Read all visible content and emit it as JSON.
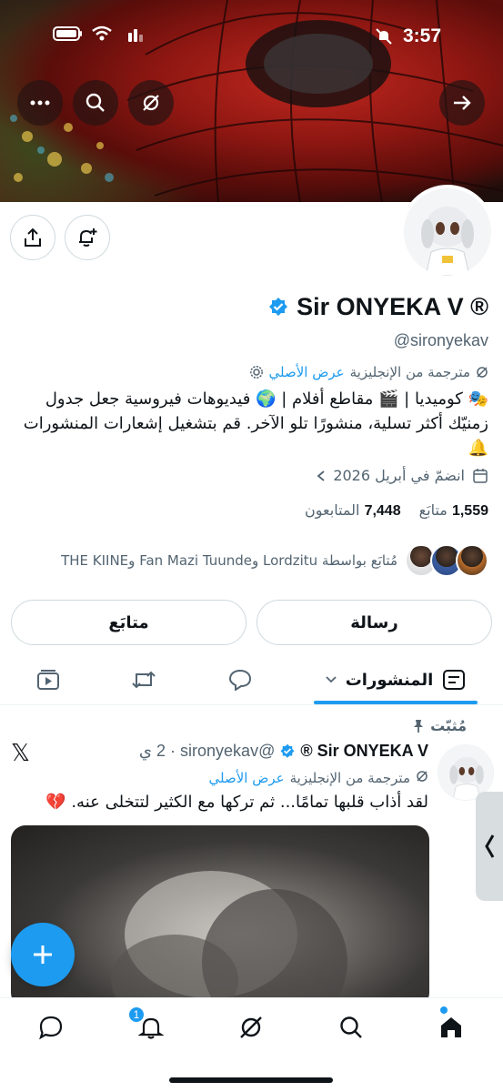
{
  "status_bar": {
    "time": "3:57"
  },
  "profile": {
    "display_name": "Sir ONYEKA V ®",
    "handle": "@sironyekav",
    "translated_label": "مترجمة من الإنجليزية",
    "show_original": "عرض الأصلي",
    "bio": "🎭 كوميديا | 🎬 مقاطع أفلام | 🌍 فيديوهات فيروسية جعل جدول زمنيّك أكثر تسلية، منشورًا تلو الآخر. قم بتشغيل إشعارات المنشورات🔔",
    "joined": "انضمّ في أبريل 2026",
    "following_count": "1,559",
    "following_label": "متابَع",
    "followers_count": "7,448",
    "followers_label": "المتابعون",
    "followed_by": "مُتابَع بواسطة Lordzitu وFan Mazi Tuunde وTHE KIINE"
  },
  "actions": {
    "message_label": "رسالة",
    "following_button_label": "متابَع"
  },
  "tabs": [
    {
      "label": "المنشورات",
      "active": true
    }
  ],
  "post": {
    "pinned_label": "مُثبّت",
    "author_name": "Sir ONYEKA V ®",
    "author_handle": "@sironyekav",
    "time": "2 ي",
    "translated_label": "مترجمة من الإنجليزية",
    "show_original": "عرض الأصلي",
    "text": "لقد أذاب قلبها تمامًا... ثم تركها مع الكثير لتتخلى عنه. 💔"
  },
  "nav": {
    "notifications_badge": "1"
  },
  "colors": {
    "accent": "#1d9bf0",
    "text": "#0f1419",
    "secondary": "#536471"
  }
}
